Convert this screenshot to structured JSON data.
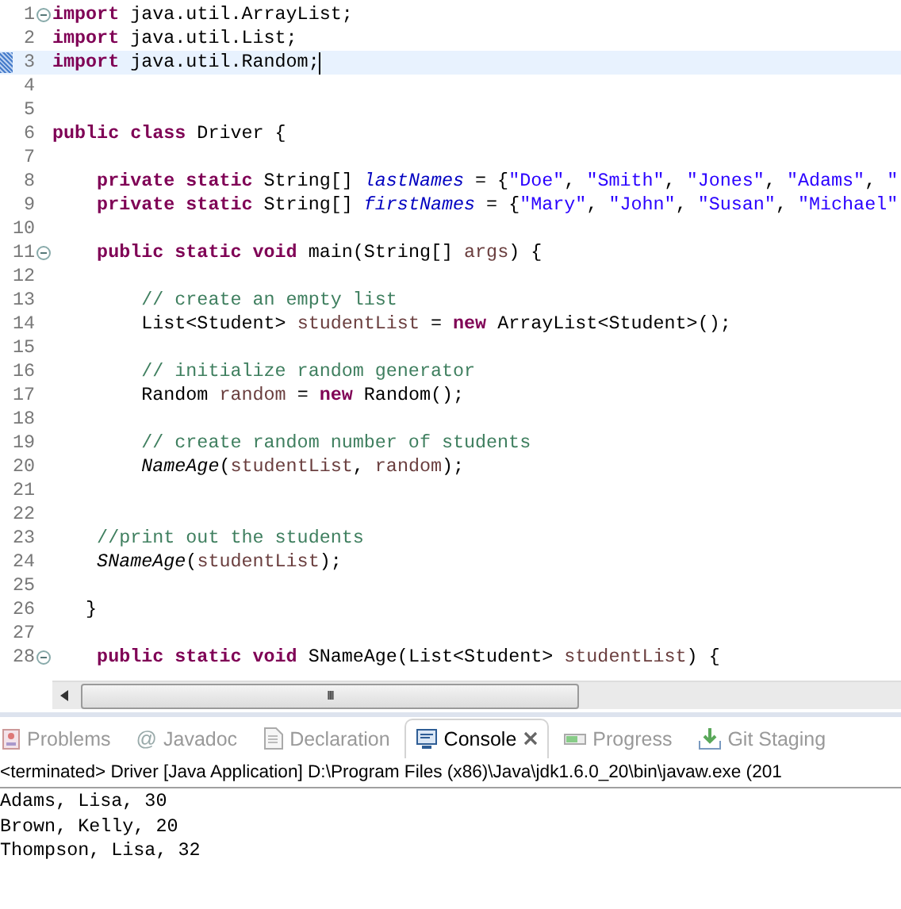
{
  "editor": {
    "lines": [
      {
        "number": "1",
        "fold": true,
        "current": false,
        "tokens": [
          {
            "kind": "keyword",
            "text": "import"
          },
          {
            "kind": "plain",
            "text": " java.util.ArrayList;"
          }
        ]
      },
      {
        "number": "2",
        "fold": false,
        "current": false,
        "tokens": [
          {
            "kind": "keyword",
            "text": "import"
          },
          {
            "kind": "plain",
            "text": " java.util.List;"
          }
        ]
      },
      {
        "number": "3",
        "fold": false,
        "current": true,
        "tokens": [
          {
            "kind": "keyword",
            "text": "import"
          },
          {
            "kind": "plain",
            "text": " java.util.Random;"
          }
        ]
      },
      {
        "number": "4",
        "fold": false,
        "current": false
      },
      {
        "number": "5",
        "fold": false,
        "current": false
      },
      {
        "number": "6",
        "fold": false,
        "current": false,
        "tokens": [
          {
            "kind": "keyword",
            "text": "public class"
          },
          {
            "kind": "plain",
            "text": " Driver {"
          }
        ]
      },
      {
        "number": "7",
        "fold": false,
        "current": false
      },
      {
        "number": "8",
        "fold": false,
        "current": false,
        "tokens": [
          {
            "kind": "keyword",
            "text": "    private static"
          },
          {
            "kind": "plain",
            "text": " String[] "
          },
          {
            "kind": "field",
            "text": "lastNames"
          },
          {
            "kind": "plain",
            "text": " = {"
          },
          {
            "kind": "string",
            "text": "\"Doe\""
          },
          {
            "kind": "plain",
            "text": ", "
          },
          {
            "kind": "string",
            "text": "\"Smith\""
          },
          {
            "kind": "plain",
            "text": ", "
          },
          {
            "kind": "string",
            "text": "\"Jones\""
          },
          {
            "kind": "plain",
            "text": ", "
          },
          {
            "kind": "string",
            "text": "\"Adams\""
          },
          {
            "kind": "plain",
            "text": ", "
          },
          {
            "kind": "string",
            "text": "\""
          }
        ]
      },
      {
        "number": "9",
        "fold": false,
        "current": false,
        "tokens": [
          {
            "kind": "keyword",
            "text": "    private static"
          },
          {
            "kind": "plain",
            "text": " String[] "
          },
          {
            "kind": "field",
            "text": "firstNames"
          },
          {
            "kind": "plain",
            "text": " = {"
          },
          {
            "kind": "string",
            "text": "\"Mary\""
          },
          {
            "kind": "plain",
            "text": ", "
          },
          {
            "kind": "string",
            "text": "\"John\""
          },
          {
            "kind": "plain",
            "text": ", "
          },
          {
            "kind": "string",
            "text": "\"Susan\""
          },
          {
            "kind": "plain",
            "text": ", "
          },
          {
            "kind": "string",
            "text": "\"Michael\""
          }
        ]
      },
      {
        "number": "10",
        "fold": false,
        "current": false
      },
      {
        "number": "11",
        "fold": true,
        "current": false,
        "tokens": [
          {
            "kind": "keyword",
            "text": "    public static void"
          },
          {
            "kind": "plain",
            "text": " main(String[] "
          },
          {
            "kind": "local",
            "text": "args"
          },
          {
            "kind": "plain",
            "text": ") {"
          }
        ]
      },
      {
        "number": "12",
        "fold": false,
        "current": false
      },
      {
        "number": "13",
        "fold": false,
        "current": false,
        "tokens": [
          {
            "kind": "comment",
            "text": "        // create an empty list"
          }
        ]
      },
      {
        "number": "14",
        "fold": false,
        "current": false,
        "tokens": [
          {
            "kind": "plain",
            "text": "        List<Student> "
          },
          {
            "kind": "local",
            "text": "studentList"
          },
          {
            "kind": "plain",
            "text": " = "
          },
          {
            "kind": "keyword",
            "text": "new"
          },
          {
            "kind": "plain",
            "text": " ArrayList<Student>();"
          }
        ]
      },
      {
        "number": "15",
        "fold": false,
        "current": false
      },
      {
        "number": "16",
        "fold": false,
        "current": false,
        "tokens": [
          {
            "kind": "comment",
            "text": "        // initialize random generator"
          }
        ]
      },
      {
        "number": "17",
        "fold": false,
        "current": false,
        "tokens": [
          {
            "kind": "plain",
            "text": "        Random "
          },
          {
            "kind": "local",
            "text": "random"
          },
          {
            "kind": "plain",
            "text": " = "
          },
          {
            "kind": "keyword",
            "text": "new"
          },
          {
            "kind": "plain",
            "text": " Random();"
          }
        ]
      },
      {
        "number": "18",
        "fold": false,
        "current": false
      },
      {
        "number": "19",
        "fold": false,
        "current": false,
        "tokens": [
          {
            "kind": "comment",
            "text": "        // create random number of students"
          }
        ]
      },
      {
        "number": "20",
        "fold": false,
        "current": false,
        "tokens": [
          {
            "kind": "method",
            "text": "        NameAge"
          },
          {
            "kind": "plain",
            "text": "("
          },
          {
            "kind": "local",
            "text": "studentList"
          },
          {
            "kind": "plain",
            "text": ", "
          },
          {
            "kind": "local",
            "text": "random"
          },
          {
            "kind": "plain",
            "text": ");"
          }
        ]
      },
      {
        "number": "21",
        "fold": false,
        "current": false
      },
      {
        "number": "22",
        "fold": false,
        "current": false
      },
      {
        "number": "23",
        "fold": false,
        "current": false,
        "tokens": [
          {
            "kind": "comment",
            "text": "    //print out the students"
          }
        ]
      },
      {
        "number": "24",
        "fold": false,
        "current": false,
        "tokens": [
          {
            "kind": "method",
            "text": "    SNameAge"
          },
          {
            "kind": "plain",
            "text": "("
          },
          {
            "kind": "local",
            "text": "studentList"
          },
          {
            "kind": "plain",
            "text": ");"
          }
        ]
      },
      {
        "number": "25",
        "fold": false,
        "current": false
      },
      {
        "number": "26",
        "fold": false,
        "current": false,
        "tokens": [
          {
            "kind": "plain",
            "text": "   }"
          }
        ]
      },
      {
        "number": "27",
        "fold": false,
        "current": false
      },
      {
        "number": "28",
        "fold": true,
        "current": false,
        "tokens": [
          {
            "kind": "keyword",
            "text": "    public static void"
          },
          {
            "kind": "plain",
            "text": " SNameAge(List<Student> "
          },
          {
            "kind": "local",
            "text": "studentList"
          },
          {
            "kind": "plain",
            "text": ") {"
          }
        ]
      }
    ],
    "scroll_grip": "III"
  },
  "panel": {
    "tabs": [
      {
        "label": "Problems",
        "selected": false,
        "closable": false
      },
      {
        "label": "Javadoc",
        "selected": false,
        "closable": false,
        "glyph": "@"
      },
      {
        "label": "Declaration",
        "selected": false,
        "closable": false
      },
      {
        "label": "Console",
        "selected": true,
        "closable": true
      },
      {
        "label": "Progress",
        "selected": false,
        "closable": false
      },
      {
        "label": "Git Staging",
        "selected": false,
        "closable": false
      }
    ],
    "status": "<terminated> Driver [Java Application] D:\\Program Files (x86)\\Java\\jdk1.6.0_20\\bin\\javaw.exe (201",
    "output": [
      "Adams, Lisa, 30",
      "Brown, Kelly, 20",
      "Thompson, Lisa, 32"
    ]
  }
}
